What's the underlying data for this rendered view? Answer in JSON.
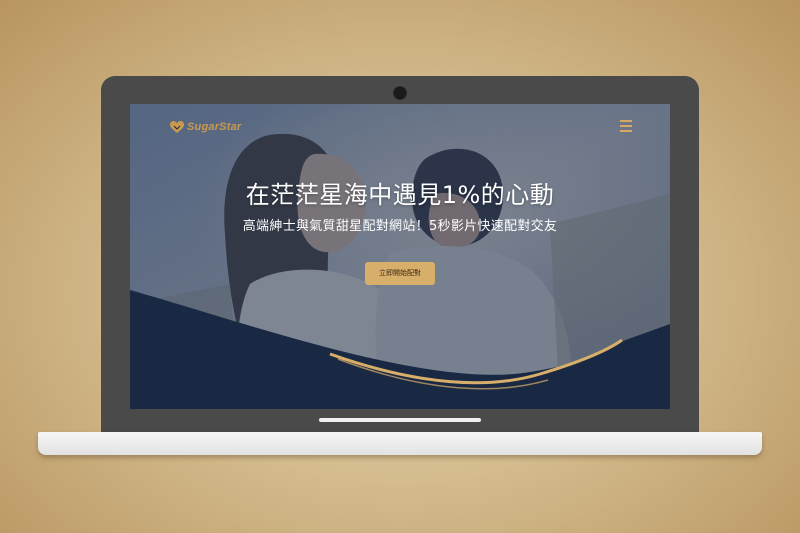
{
  "brand": {
    "logo_text": "SugarStar",
    "accent_color": "#d8ae6b",
    "navy_color": "#1a2943"
  },
  "header": {
    "menu_icon": "hamburger-menu-icon"
  },
  "hero": {
    "headline": "在茫茫星海中遇見1%的心動",
    "subheadline": "高端紳士與氣質甜星配對網站！5秒影片快速配對交友",
    "cta_label": "立即開始配對"
  }
}
